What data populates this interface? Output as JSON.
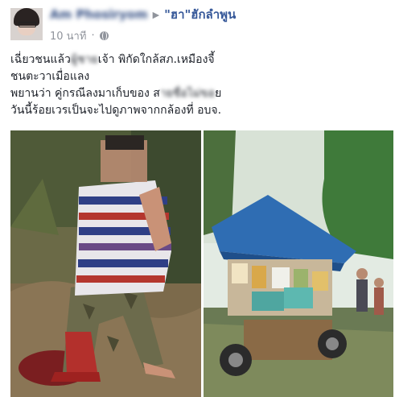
{
  "post": {
    "author": "Am Phosiryom",
    "arrow": "▶",
    "group": "\"ฮา\"ฮักลำพูน",
    "time": "10 นาที",
    "separator": "·",
    "privacy_icon": "globe-icon",
    "lines": [
      {
        "before": "เฉี่ยวชนแล้ว",
        "blur": "ผู้ชาย",
        "after": "เจ้า พิกัดใกล้สภ.เหมืองจี้"
      },
      {
        "text": "ชนตะวาเมื่อแลง"
      },
      {
        "before": "พยานว่า คู่กรณีลงมาเก็บของ ส",
        "blur": "ายชื่อไม่ขอ",
        "after": "ย"
      },
      {
        "text": "วันนี้ร้อยเวรเป็นจะไปดูภาพจากกล้องที่ อบจ."
      }
    ]
  },
  "colors": {
    "link": "#365899",
    "muted": "#90949c",
    "text": "#1d2129",
    "vendor_canopy": "#2f6db3"
  }
}
